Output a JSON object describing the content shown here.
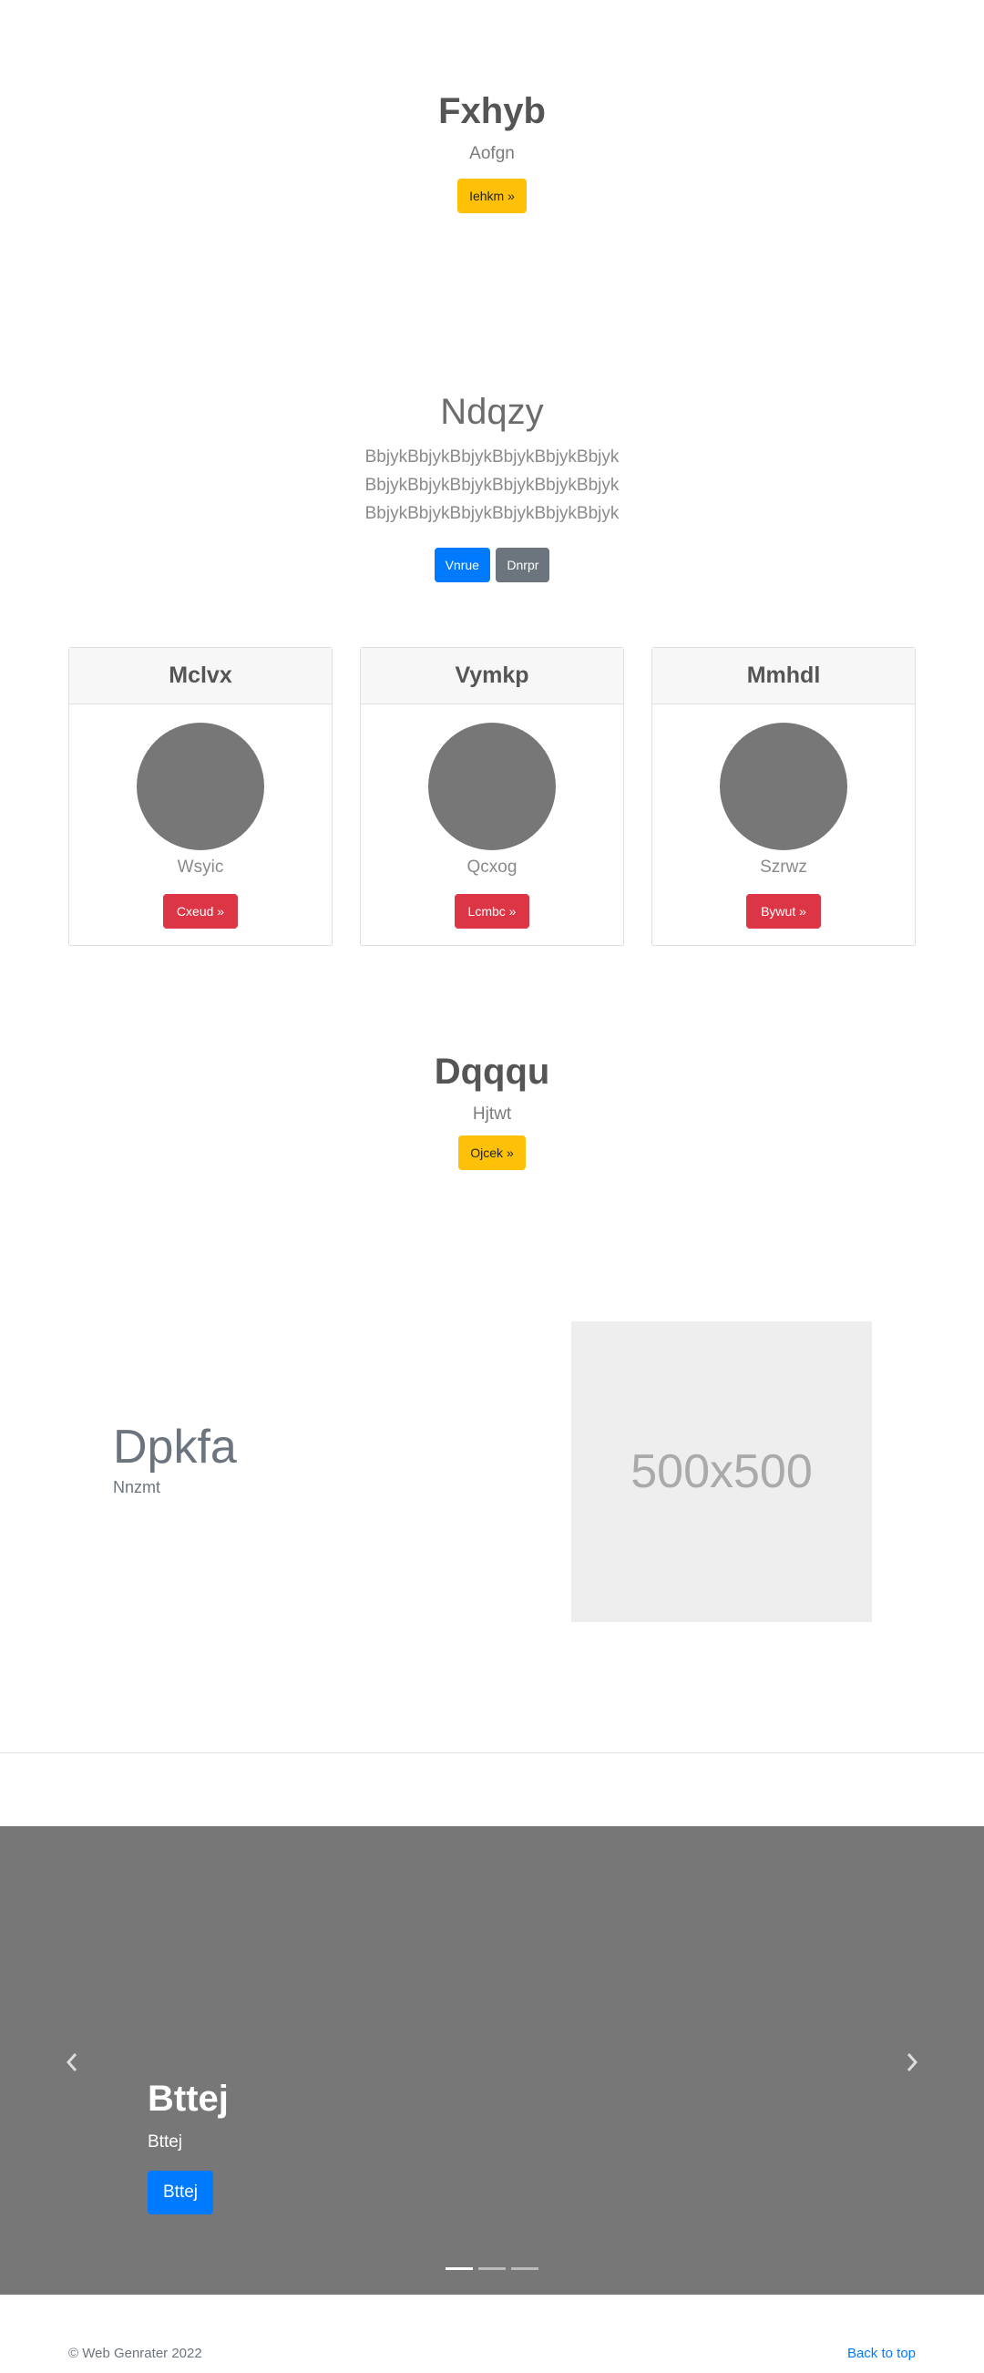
{
  "hero1": {
    "title": "Fxhyb",
    "subtitle": "Aofgn",
    "button": "Iehkm »"
  },
  "lead": {
    "title": "Ndqzy",
    "text": "BbjykBbjykBbjykBbjykBbjykBbjyk BbjykBbjykBbjykBbjykBbjykBbjyk BbjykBbjykBbjykBbjykBbjykBbjyk",
    "primary_button": "Vnrue",
    "secondary_button": "Dnrpr"
  },
  "cards": [
    {
      "title": "Mclvx",
      "name": "Wsyic",
      "button": "Cxeud »"
    },
    {
      "title": "Vymkp",
      "name": "Qcxog",
      "button": "Lcmbc »"
    },
    {
      "title": "Mmhdl",
      "name": "Szrwz",
      "button": "Bywut »"
    }
  ],
  "hero2": {
    "title": "Dqqqu",
    "subtitle": "Hjtwt",
    "button": "Ojcek »"
  },
  "feature": {
    "title": "Dpkfa",
    "subtitle": "Nnzmt",
    "image_placeholder": "500x500"
  },
  "carousel": {
    "caption_title": "Bttej",
    "caption_text": "Bttej",
    "caption_button": "Bttej",
    "prev_icon": "chevron-left-icon",
    "next_icon": "chevron-right-icon",
    "slide_count": 3,
    "active_index": 0
  },
  "footer": {
    "copyright": "© Web Genrater 2022",
    "back_to_top": "Back to top"
  },
  "colors": {
    "warning": "#ffc107",
    "primary": "#007bff",
    "secondary": "#6c757d",
    "danger": "#dc3545",
    "carousel_bg": "#777777"
  }
}
